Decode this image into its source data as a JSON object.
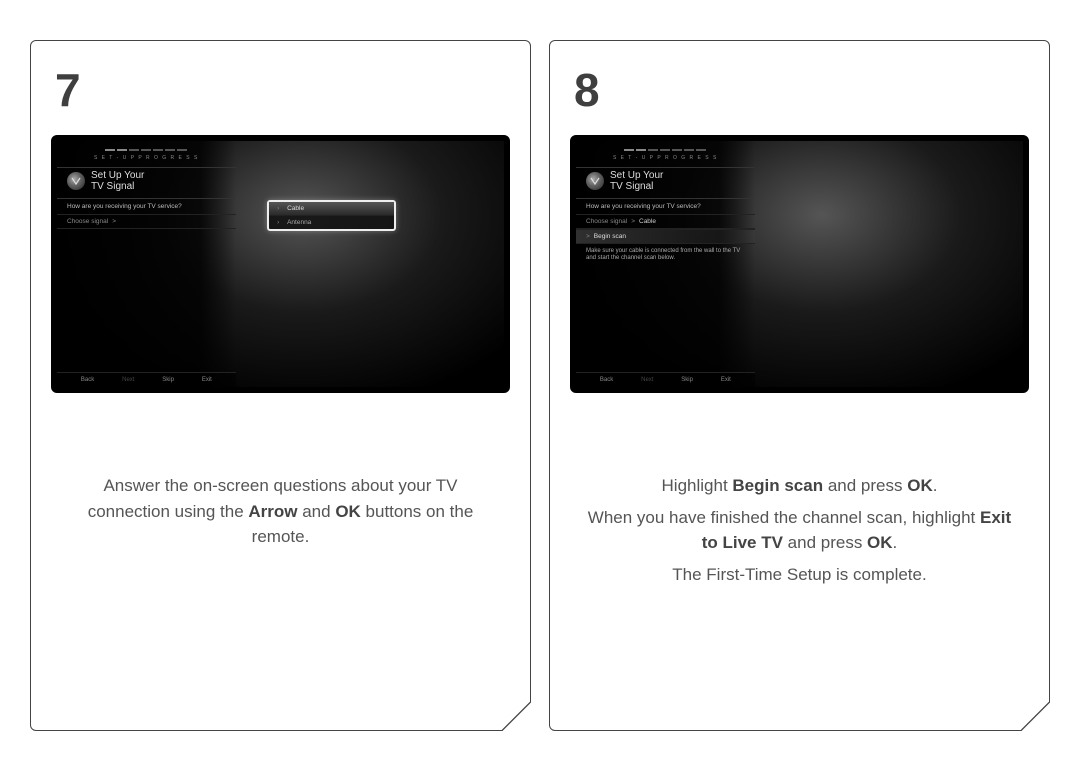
{
  "step7": {
    "number": "7",
    "tv": {
      "progress_label": "S E T - U P   P R O G R E S S",
      "title_line1": "Set Up Your",
      "title_line2": "TV Signal",
      "question": "How are you receiving your TV service?",
      "row_label": "Choose signal",
      "row_arrow": ">",
      "popup_opt1": "Cable",
      "popup_opt2": "Antenna",
      "nav": {
        "back": "Back",
        "next": "Next",
        "skip": "Skip",
        "exit": "Exit"
      }
    },
    "instruction_parts": {
      "t1": "Answer the on-screen questions about your TV connection using the ",
      "b1": "Arrow",
      "t2": " and ",
      "b2": "OK",
      "t3": " buttons on the remote."
    }
  },
  "step8": {
    "number": "8",
    "tv": {
      "progress_label": "S E T - U P   P R O G R E S S",
      "title_line1": "Set Up Your",
      "title_line2": "TV Signal",
      "question": "How are you receiving your TV service?",
      "row_label": "Choose signal",
      "row_arrow": ">",
      "row_value": "Cable",
      "begin_scan_arrow": ">",
      "begin_scan": "Begin scan",
      "info": "Make sure your cable is connected from the wall to the TV and start the channel scan below.",
      "nav": {
        "back": "Back",
        "next": "Next",
        "skip": "Skip",
        "exit": "Exit"
      }
    },
    "instruction_line1": {
      "t1": "Highlight ",
      "b1": "Begin scan",
      "t2": " and press ",
      "b2": "OK",
      "t3": "."
    },
    "instruction_line2": {
      "t1": "When you have finished the channel scan, highlight ",
      "b1": "Exit to Live TV",
      "t2": " and press ",
      "b2": "OK",
      "t3": "."
    },
    "instruction_line3": "The First-Time Setup is complete."
  }
}
